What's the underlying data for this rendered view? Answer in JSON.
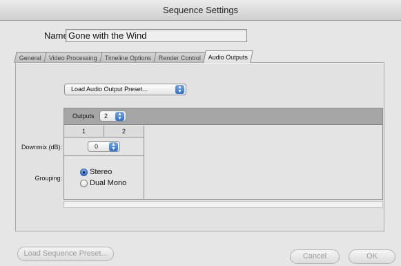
{
  "window": {
    "title": "Sequence Settings"
  },
  "name_field": {
    "label": "Name:",
    "value": "Gone with the Wind"
  },
  "tabs": [
    {
      "label": "General",
      "active": false
    },
    {
      "label": "Video Processing",
      "active": false
    },
    {
      "label": "Timeline Options",
      "active": false
    },
    {
      "label": "Render Control",
      "active": false
    },
    {
      "label": "Audio Outputs",
      "active": true
    }
  ],
  "audio_outputs": {
    "preset_popup": "Load Audio Output Preset...",
    "outputs_label": "Outputs",
    "outputs_value": "2",
    "channels": [
      "1",
      "2"
    ],
    "downmix_label": "Downmix (dB):",
    "downmix_value": "0",
    "grouping_label": "Grouping:",
    "grouping_options": [
      {
        "label": "Stereo",
        "selected": true
      },
      {
        "label": "Dual Mono",
        "selected": false
      }
    ]
  },
  "footer": {
    "load_preset_button": "Load Sequence Preset...",
    "cancel_button": "Cancel",
    "ok_button": "OK"
  },
  "icons": {
    "popup_stepper": "up-down-arrows-icon"
  }
}
